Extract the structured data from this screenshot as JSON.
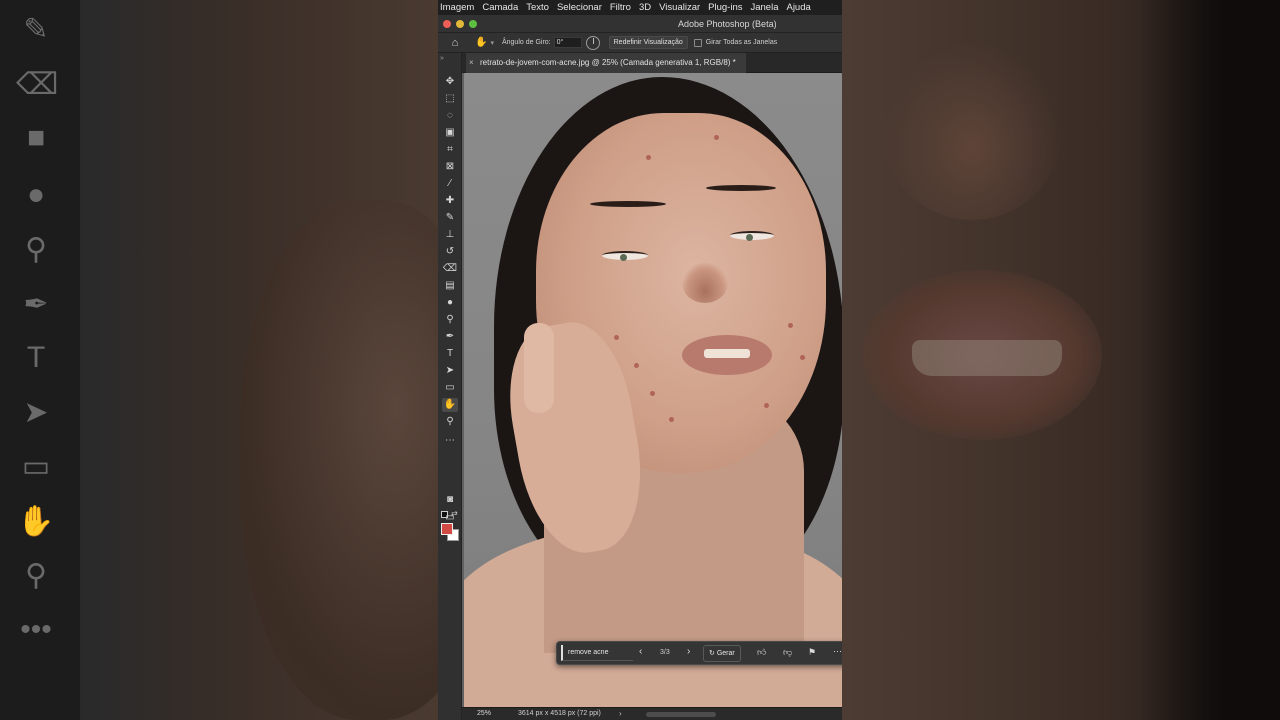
{
  "menubar": {
    "items": [
      "Imagem",
      "Camada",
      "Texto",
      "Selecionar",
      "Filtro",
      "3D",
      "Visualizar",
      "Plug-ins",
      "Janela",
      "Ajuda"
    ]
  },
  "window": {
    "title": "Adobe Photoshop (Beta)"
  },
  "options_bar": {
    "rotation_label": "Ângulo de Giro:",
    "rotation_value": "0°",
    "reset_view_label": "Redefinir Visualização",
    "rotate_all_label": "Girar Todas as Janelas",
    "rotate_all_checked": false
  },
  "document_tab": {
    "title": "retrato-de-jovem-com-acne.jpg @ 25% (Camada generativa 1, RGB/8) *"
  },
  "colors": {
    "foreground": "#d24a44",
    "background": "#ffffff"
  },
  "generative_bar": {
    "prompt": "remove acne",
    "variation_counter": "3/3",
    "generate_label": "Gerar"
  },
  "status_bar": {
    "zoom": "25%",
    "dimensions": "3614 px x 4518 px (72 ppi)"
  }
}
